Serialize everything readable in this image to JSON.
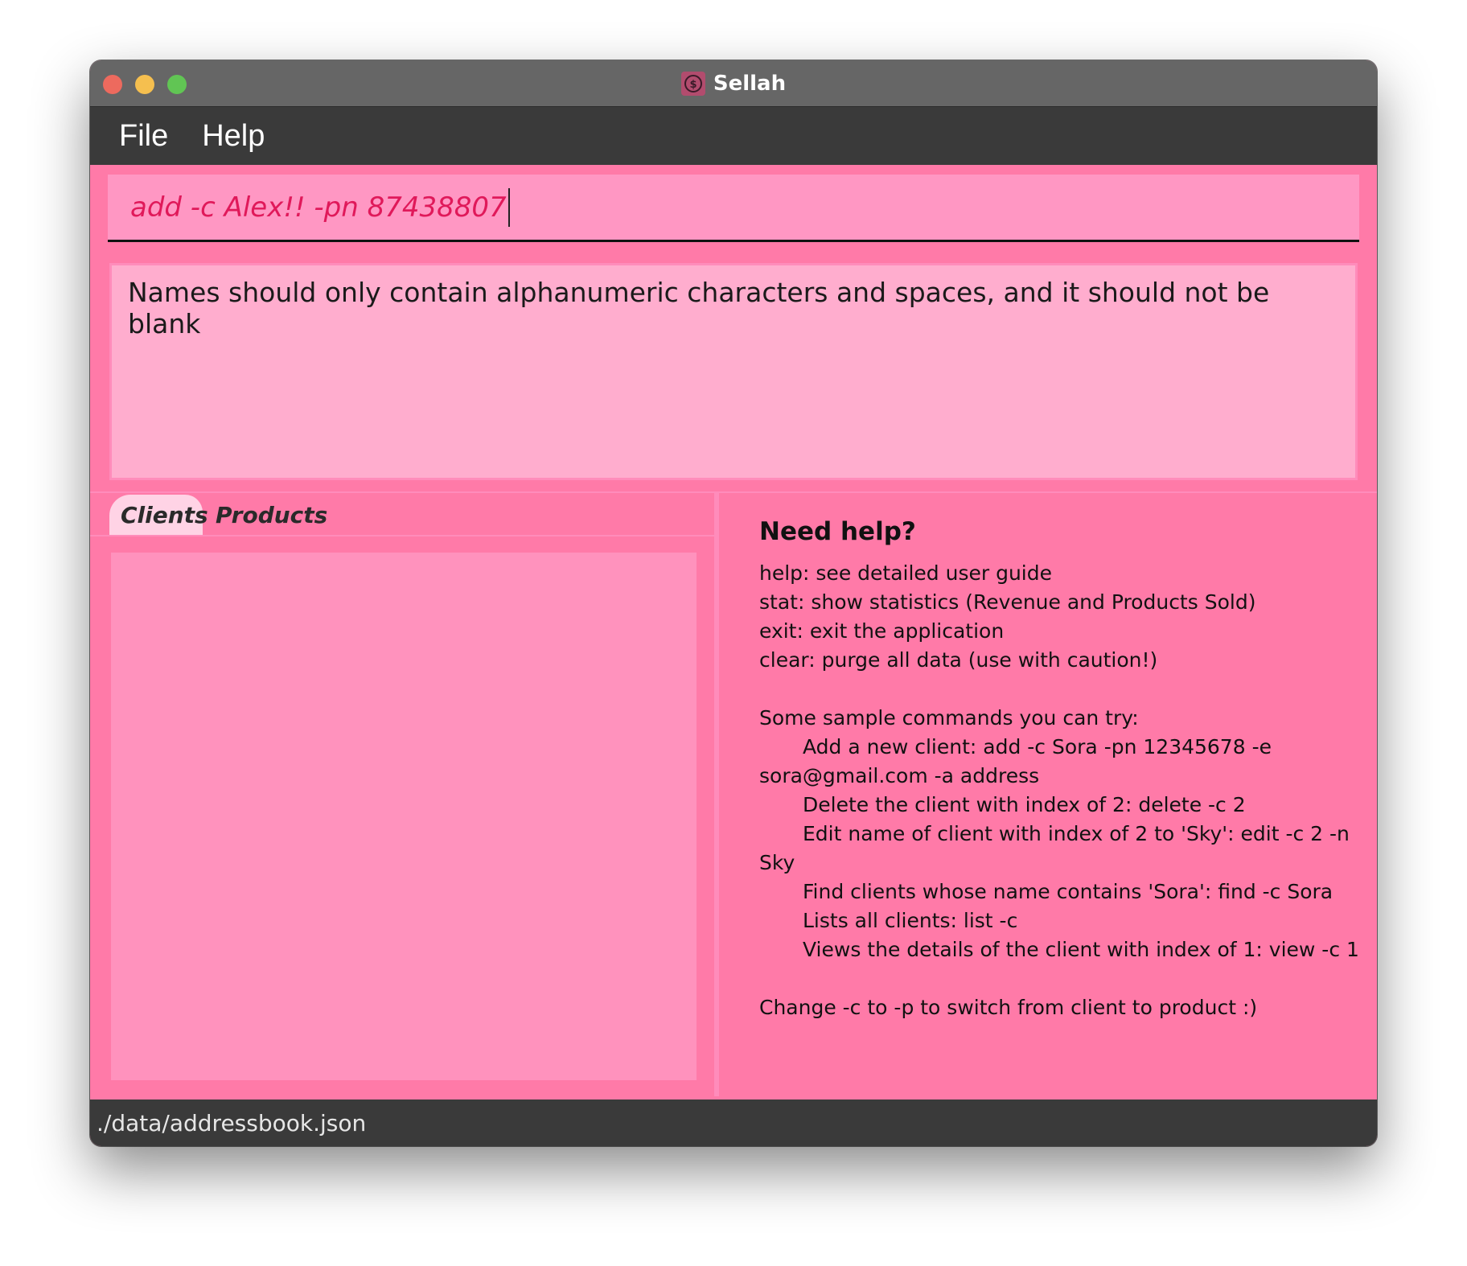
{
  "window": {
    "title": "Sellah",
    "app_icon": "dollar-coin-icon"
  },
  "menu": {
    "items": [
      {
        "label": "File"
      },
      {
        "label": "Help"
      }
    ]
  },
  "command_box": {
    "value": "add -c Alex!! -pn 87438807",
    "text_color": "#e0195a"
  },
  "result_display": {
    "text": "Names should only contain alphanumeric characters and spaces, and it should not be blank"
  },
  "tabs": [
    {
      "label": "Clients",
      "selected": true
    },
    {
      "label": "Products",
      "selected": false
    }
  ],
  "help_panel": {
    "title": "Need help?",
    "lines": [
      {
        "text": "help: see detailed user guide",
        "indent": false
      },
      {
        "text": "stat: show statistics (Revenue and Products Sold)",
        "indent": false
      },
      {
        "text": "exit: exit the application",
        "indent": false
      },
      {
        "text": "clear: purge all data (use with caution!)",
        "indent": false
      },
      {
        "text": "",
        "indent": false
      },
      {
        "text": "Some sample commands you can try:",
        "indent": false
      },
      {
        "text": "Add a new client: add -c Sora -pn 12345678 -e sora@gmail.com -a address",
        "indent": true
      },
      {
        "text": "Delete the client with index of 2: delete -c 2",
        "indent": true
      },
      {
        "text": "Edit name of client with index of 2 to 'Sky': edit -c 2 -n Sky",
        "indent": true
      },
      {
        "text": "Find clients whose name contains 'Sora': find -c Sora",
        "indent": true
      },
      {
        "text": "Lists all clients: list -c",
        "indent": true
      },
      {
        "text": "Views the details of the client with index of 1: view -c 1",
        "indent": true
      },
      {
        "text": "",
        "indent": false
      },
      {
        "text": "Change -c to -p to switch from client to product :)",
        "indent": false
      }
    ]
  },
  "status_bar": {
    "file_path": "./data/addressbook.json"
  },
  "colors": {
    "background": "#ff7aa8",
    "command_box": "#ff97c3",
    "result_box": "#ffadce",
    "list_panel": "#ff92bd",
    "selected_tab": "#ffd3e5",
    "menubar": "#3a3a3a",
    "titlebar": "#666666"
  }
}
